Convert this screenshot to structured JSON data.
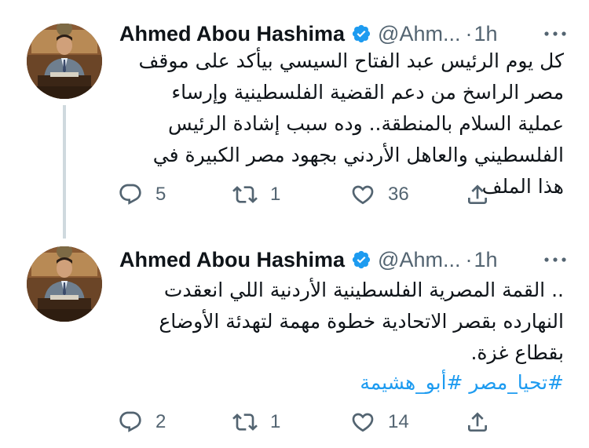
{
  "tweets": [
    {
      "author_name": "Ahmed Abou Hashima",
      "handle": "@Ahm...",
      "dot": "·",
      "time": "1h",
      "text": "كل يوم الرئيس عبد الفتاح السيسي بيأكد على موقف مصر الراسخ من دعم القضية الفلسطينية وإرساء عملية السلام بالمنطقة.. وده سبب إشادة الرئيس الفلسطيني والعاهل الأردني بجهود مصر الكبيرة في هذا الملف",
      "replies": "5",
      "retweets": "1",
      "likes": "36"
    },
    {
      "author_name": "Ahmed Abou Hashima",
      "handle": "@Ahm...",
      "dot": "·",
      "time": "1h",
      "text": "القمة المصرية الفلسطينية الأردنية اللي انعقدت النهارده بقصر الاتحادية خطوة مهمة لتهدئة الأوضاع بقطاع غزة.",
      "text_lead": "..",
      "hashtags": [
        "#تحيا_مصر",
        "#أبو_هشيمة"
      ],
      "replies": "2",
      "retweets": "1",
      "likes": "14"
    }
  ],
  "icons": {
    "verified": "verified-badge-icon",
    "more": "more-horizontal-icon",
    "reply": "reply-icon",
    "retweet": "retweet-icon",
    "like": "heart-icon",
    "share": "share-icon"
  },
  "colors": {
    "accent": "#1d9bf0",
    "secondary_text": "#536471",
    "icon_gray": "#536471",
    "thread_line": "#cfd9de"
  }
}
